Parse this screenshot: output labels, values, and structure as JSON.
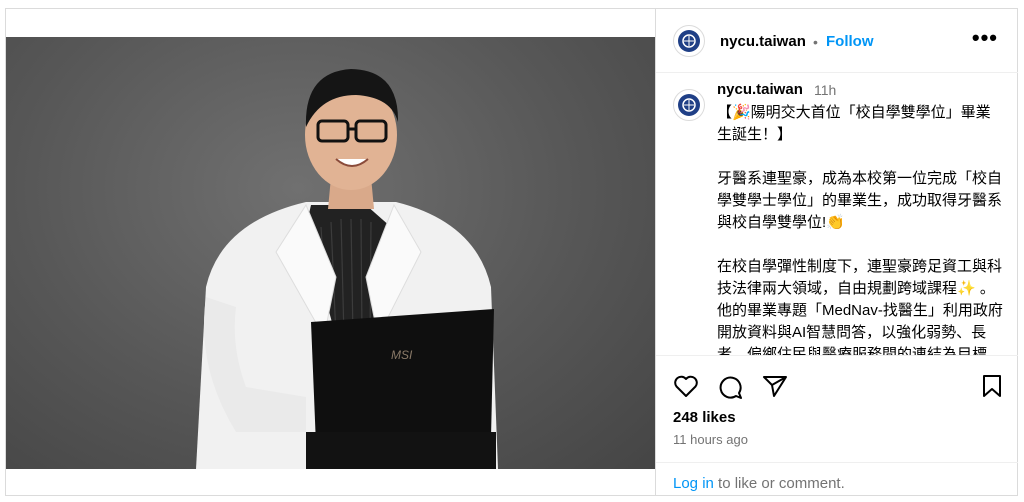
{
  "account": {
    "username": "nycu.taiwan",
    "follow_label": "Follow",
    "separator": "•"
  },
  "post": {
    "time_short": "11h",
    "caption": "【🎉陽明交大首位「校自學雙學位」畢業生誕生！】\n\n牙醫系連聖豪，成為本校第一位完成「校自學雙學士學位」的畢業生，成功取得牙醫系與校自學雙學位!👏\n\n在校自學彈性制度下，連聖豪跨足資工與科技法律兩大領域，自由規劃跨域課程✨ 。他的畢業專題「MedNav-找醫生」利用政府開放資料與AI智慧問答，以強化弱勢、長者、偏鄉住民與醫療服務間的連結為目標，讓真正有需要的人也能被看見。",
    "likes": "248 likes",
    "time_ago": "11 hours ago",
    "laptop_brand": "MSI"
  },
  "footer": {
    "login_link": "Log in",
    "login_rest": " to like or comment."
  },
  "icons": {
    "more": "more-options-icon",
    "like": "heart-icon",
    "comment": "comment-icon",
    "share": "share-icon",
    "save": "bookmark-icon"
  },
  "colors": {
    "link": "#0095f6",
    "muted": "#737373",
    "border": "#dbdbdb"
  }
}
